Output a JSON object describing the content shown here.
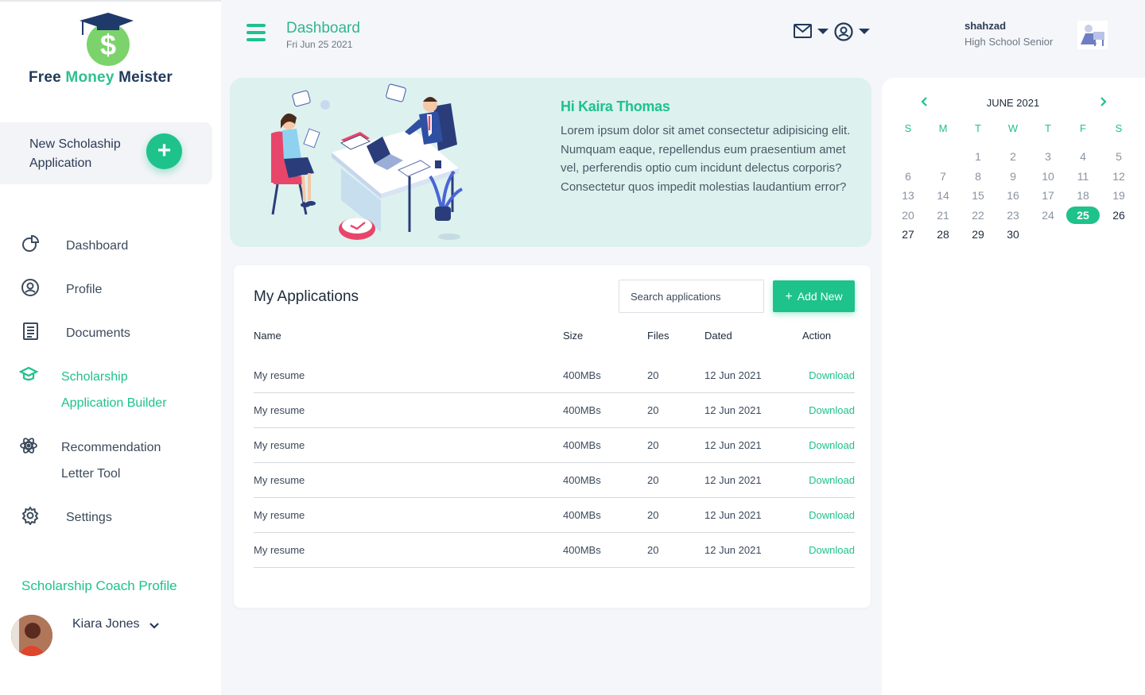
{
  "brand": {
    "name_part1": "Free ",
    "name_part2": "Money",
    "name_part3": " Meister",
    "accent": "#1ec28b"
  },
  "sidebar": {
    "new_application_label": "New Scholaship Application",
    "new_application_button": "+",
    "items": [
      {
        "label": "Dashboard",
        "icon": "pie-chart-icon"
      },
      {
        "label": "Profile",
        "icon": "user-circle-icon"
      },
      {
        "label": "Documents",
        "icon": "document-icon"
      },
      {
        "label_line1": "Scholarship",
        "label_line2": "Application Builder",
        "icon": "graduation-cap-icon",
        "active": true
      },
      {
        "label_line1": "Recommendation",
        "label_line2": "Letter Tool",
        "icon": "atom-icon"
      },
      {
        "label": "Settings",
        "icon": "gear-icon"
      }
    ],
    "coach_title": "Scholarship Coach Profile",
    "coach_name": "Kiara Jones"
  },
  "header": {
    "title": "Dashboard",
    "date": "Fri Jun 25 2021",
    "user_name": "shahzad",
    "user_role": "High School Senior"
  },
  "hero": {
    "greeting": "Hi Kaira Thomas",
    "text": "Lorem ipsum dolor sit amet consectetur adipisicing elit. Numquam eaque, repellendus eum praesentium amet vel, perferendis optio cum incidunt delectus corporis? Consectetur quos impedit molestias laudantium error?"
  },
  "applications": {
    "title": "My Applications",
    "search_placeholder": "Search applications",
    "add_button": "Add New",
    "columns": [
      "Name",
      "Size",
      "Files",
      "Dated",
      "Action"
    ],
    "rows": [
      {
        "name": "My resume",
        "size": "400MBs",
        "files": "20",
        "dated": "12 Jun 2021",
        "action": "Download"
      },
      {
        "name": "My resume",
        "size": "400MBs",
        "files": "20",
        "dated": "12 Jun 2021",
        "action": "Download"
      },
      {
        "name": "My resume",
        "size": "400MBs",
        "files": "20",
        "dated": "12 Jun 2021",
        "action": "Download"
      },
      {
        "name": "My resume",
        "size": "400MBs",
        "files": "20",
        "dated": "12 Jun 2021",
        "action": "Download"
      },
      {
        "name": "My resume",
        "size": "400MBs",
        "files": "20",
        "dated": "12 Jun 2021",
        "action": "Download"
      },
      {
        "name": "My resume",
        "size": "400MBs",
        "files": "20",
        "dated": "12 Jun 2021",
        "action": "Download"
      }
    ]
  },
  "calendar": {
    "month": "JUNE 2021",
    "weekdays": [
      "S",
      "M",
      "T",
      "W",
      "T",
      "F",
      "S"
    ],
    "first_weekday_index": 2,
    "days_in_month": 30,
    "today": 25
  }
}
